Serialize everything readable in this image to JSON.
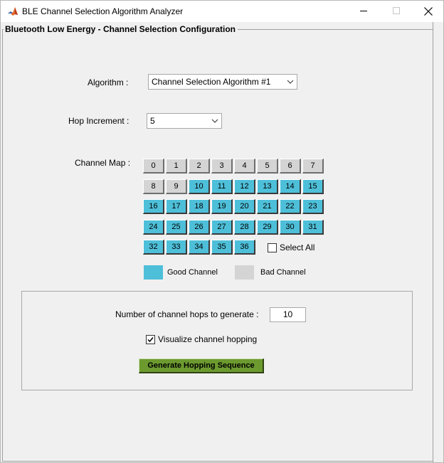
{
  "window": {
    "title": "BLE Channel Selection Algorithm Analyzer"
  },
  "panel": {
    "title": "Bluetooth Low Energy - Channel Selection Configuration"
  },
  "algorithm": {
    "label": "Algorithm  :",
    "value": "Channel Selection Algorithm #1"
  },
  "hop_increment": {
    "label": "Hop Increment  :",
    "value": "5"
  },
  "channel_map": {
    "label": "Channel Map  :",
    "channels": [
      {
        "number": "0",
        "state": "bad"
      },
      {
        "number": "1",
        "state": "bad"
      },
      {
        "number": "2",
        "state": "bad"
      },
      {
        "number": "3",
        "state": "bad"
      },
      {
        "number": "4",
        "state": "bad"
      },
      {
        "number": "5",
        "state": "bad"
      },
      {
        "number": "6",
        "state": "bad"
      },
      {
        "number": "7",
        "state": "bad"
      },
      {
        "number": "8",
        "state": "bad"
      },
      {
        "number": "9",
        "state": "bad"
      },
      {
        "number": "10",
        "state": "good"
      },
      {
        "number": "11",
        "state": "good"
      },
      {
        "number": "12",
        "state": "good"
      },
      {
        "number": "13",
        "state": "good"
      },
      {
        "number": "14",
        "state": "good"
      },
      {
        "number": "15",
        "state": "good"
      },
      {
        "number": "16",
        "state": "good"
      },
      {
        "number": "17",
        "state": "good"
      },
      {
        "number": "18",
        "state": "good"
      },
      {
        "number": "19",
        "state": "good"
      },
      {
        "number": "20",
        "state": "good"
      },
      {
        "number": "21",
        "state": "good"
      },
      {
        "number": "22",
        "state": "good"
      },
      {
        "number": "23",
        "state": "good"
      },
      {
        "number": "24",
        "state": "good"
      },
      {
        "number": "25",
        "state": "good"
      },
      {
        "number": "26",
        "state": "good"
      },
      {
        "number": "27",
        "state": "good"
      },
      {
        "number": "28",
        "state": "good"
      },
      {
        "number": "29",
        "state": "good"
      },
      {
        "number": "30",
        "state": "good"
      },
      {
        "number": "31",
        "state": "good"
      },
      {
        "number": "32",
        "state": "good"
      },
      {
        "number": "33",
        "state": "good"
      },
      {
        "number": "34",
        "state": "good"
      },
      {
        "number": "35",
        "state": "good"
      },
      {
        "number": "36",
        "state": "good"
      }
    ],
    "select_all_label": "Select All",
    "select_all_checked": false
  },
  "legend": {
    "good_label": "Good Channel",
    "bad_label": "Bad Channel",
    "good_color": "#4ebfd9",
    "bad_color": "#d4d4d4"
  },
  "hops": {
    "label": "Number of channel hops to generate :",
    "value": "10"
  },
  "visualize": {
    "label": "Visualize channel hopping",
    "checked": true
  },
  "generate_button": {
    "label": "Generate Hopping Sequence",
    "color": "#6c9a2f"
  }
}
